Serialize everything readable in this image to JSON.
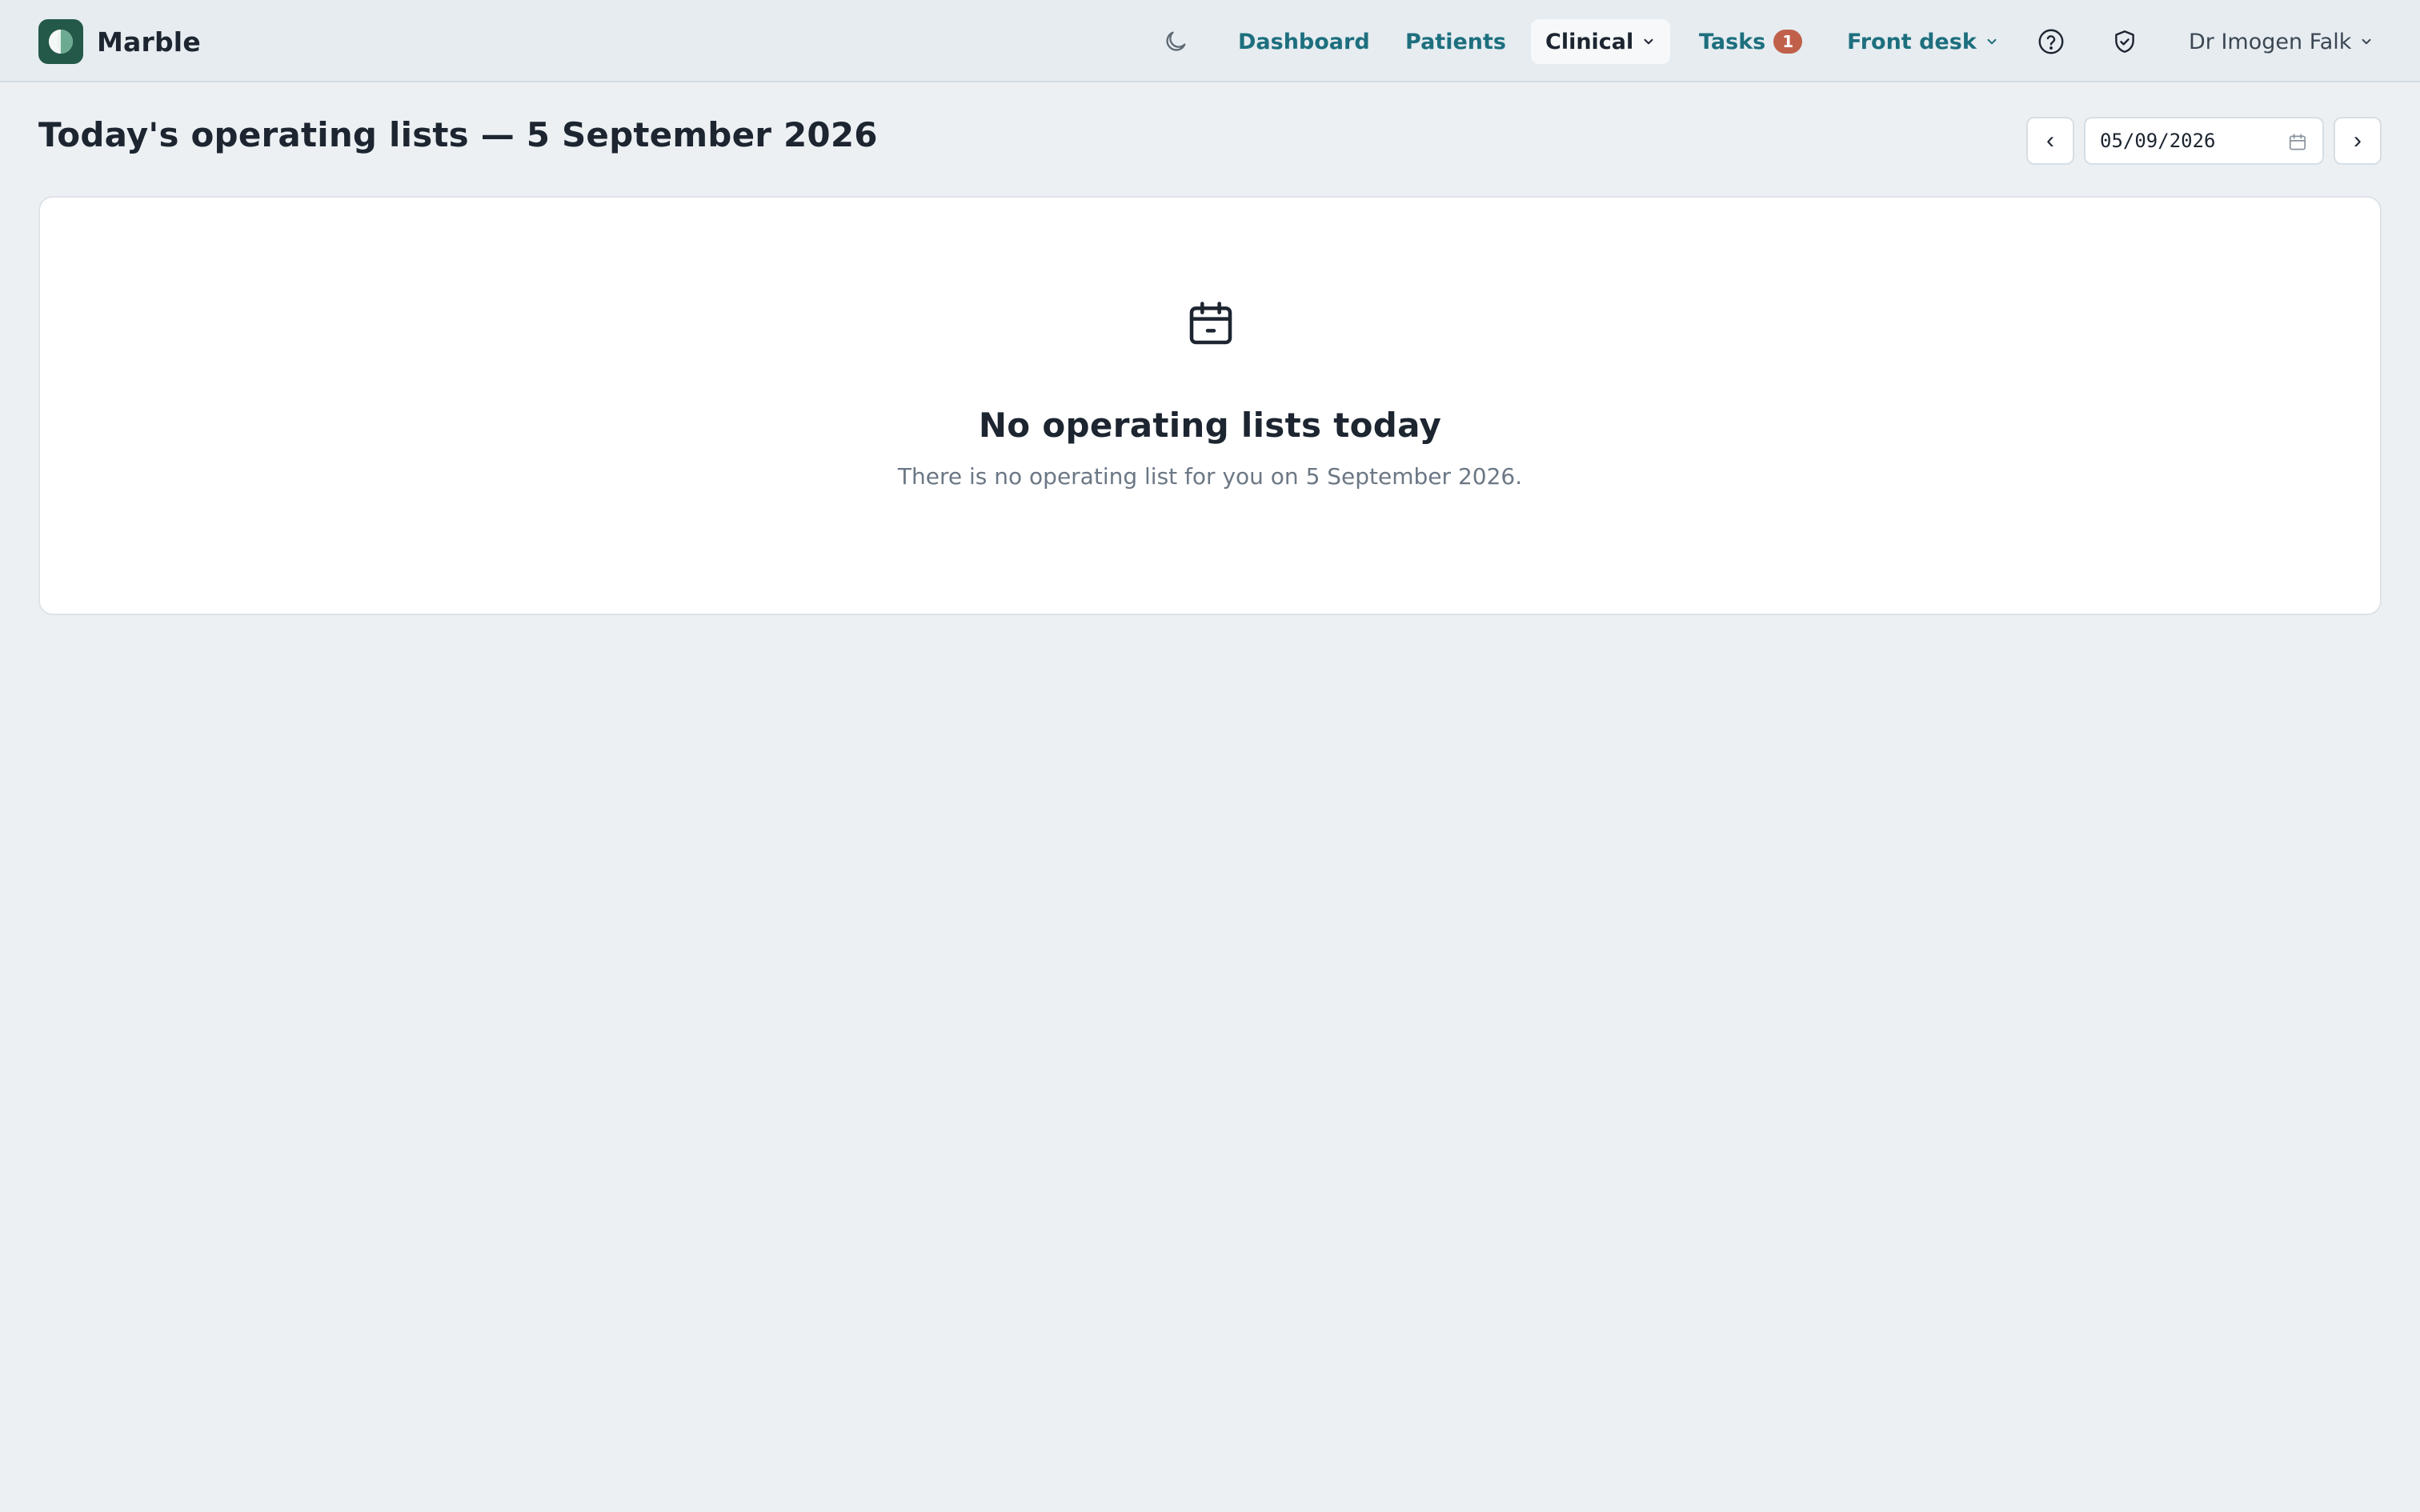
{
  "app": {
    "name": "Marble"
  },
  "nav": {
    "theme_icon": "moon-icon",
    "items": [
      {
        "label": "Dashboard"
      },
      {
        "label": "Patients"
      },
      {
        "label": "Clinical",
        "active": true,
        "has_menu": true
      },
      {
        "label": "Tasks",
        "badge": "1"
      },
      {
        "label": "Front desk",
        "has_menu": true
      }
    ],
    "help_icon": "help-circle-icon",
    "shield_icon": "shield-check-icon",
    "user": {
      "name": "Dr Imogen Falk",
      "has_menu": true
    }
  },
  "page": {
    "title": "Today's operating lists — 5 September 2026"
  },
  "date_picker": {
    "prev_label": "‹",
    "value": "05/09/2026",
    "next_label": "›",
    "icon": "calendar-icon"
  },
  "empty_state": {
    "icon": "calendar-icon",
    "title": "No operating lists today",
    "message": "There is no operating list for you on 5 September 2026."
  },
  "colors": {
    "background": "#ecf0f3",
    "topbar": "#e6ecf0",
    "link": "#1d6f7e",
    "brand_logo": "#24594a",
    "badge": "#c0604b",
    "text": "#1c2530",
    "muted_text": "#6b7784"
  }
}
